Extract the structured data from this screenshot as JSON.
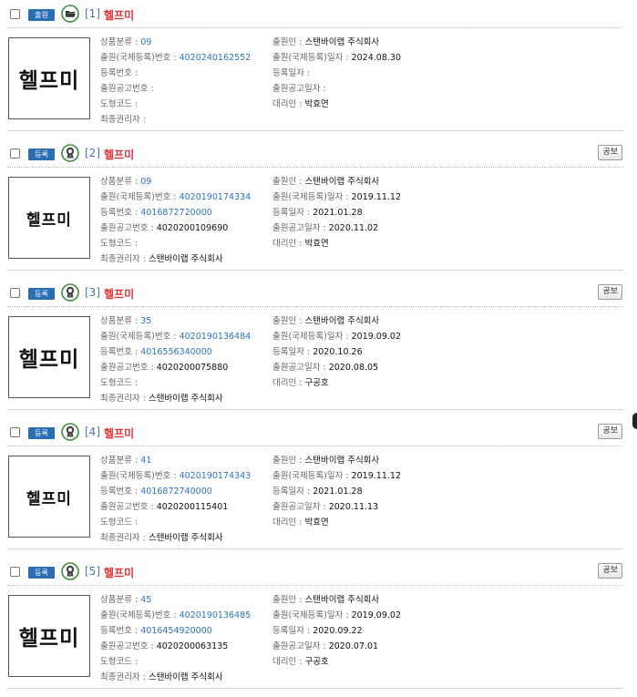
{
  "labels": {
    "class": "상품분류",
    "app_no": "출원(국제등록)번호",
    "reg_no": "등록번호",
    "pub_no": "출원공고번호",
    "design_code": "도형코드",
    "final_holder": "최종권리자",
    "applicant": "출원인",
    "app_date": "출원(국제등록)일자",
    "reg_date": "등록일자",
    "pub_date": "출원공고일자",
    "agent": "대리인",
    "sep": " : "
  },
  "gongbo_label": "공보",
  "colors": {
    "badge_bg": "#2a6fb4",
    "title": "#e0363a",
    "link": "#2f73b8",
    "number": "#4a74a8"
  },
  "results": [
    {
      "badge": "출원",
      "status_icon": "folder-open-icon",
      "number": "[1]",
      "title": "헬프미",
      "mark_text": "헬프미",
      "show_gongbo": false,
      "class": "09",
      "app_no": "4020240162552",
      "reg_no": "",
      "pub_no": "",
      "design_code": "",
      "final_holder": "",
      "applicant": "스탠바이랩 주식회사",
      "app_date": "2024.08.30",
      "reg_date": "",
      "pub_date": "",
      "agent": "박효연"
    },
    {
      "badge": "등록",
      "status_icon": "registered-seal-icon",
      "number": "[2]",
      "title": "헬프미",
      "mark_text": "헬프미",
      "show_gongbo": true,
      "class": "09",
      "app_no": "4020190174334",
      "reg_no": "4016872720000",
      "pub_no": "4020200109690",
      "design_code": "",
      "final_holder": "스탠바이랩 주식회사",
      "applicant": "스탠바이랩 주식회사",
      "app_date": "2019.11.12",
      "reg_date": "2021.01.28",
      "pub_date": "2020.11.02",
      "agent": "박효연"
    },
    {
      "badge": "등록",
      "status_icon": "registered-seal-icon",
      "number": "[3]",
      "title": "헬프미",
      "mark_text": "헬프미",
      "show_gongbo": true,
      "class": "35",
      "app_no": "4020190136484",
      "reg_no": "4016556340000",
      "pub_no": "4020200075880",
      "design_code": "",
      "final_holder": "스탠바이랩 주식회사",
      "applicant": "스탠바이랩 주식회사",
      "app_date": "2019.09.02",
      "reg_date": "2020.10.26",
      "pub_date": "2020.08.05",
      "agent": "구공호"
    },
    {
      "badge": "등록",
      "status_icon": "registered-seal-icon",
      "number": "[4]",
      "title": "헬프미",
      "mark_text": "헬프미",
      "show_gongbo": true,
      "class": "41",
      "app_no": "4020190174343",
      "reg_no": "4016872740000",
      "pub_no": "4020200115401",
      "design_code": "",
      "final_holder": "스탠바이랩 주식회사",
      "applicant": "스탠바이랩 주식회사",
      "app_date": "2019.11.12",
      "reg_date": "2021.01.28",
      "pub_date": "2020.11.13",
      "agent": "박효연"
    },
    {
      "badge": "등록",
      "status_icon": "registered-seal-icon",
      "number": "[5]",
      "title": "헬프미",
      "mark_text": "헬프미",
      "show_gongbo": true,
      "class": "45",
      "app_no": "4020190136485",
      "reg_no": "4016454920000",
      "pub_no": "4020200063135",
      "design_code": "",
      "final_holder": "스탠바이랩 주식회사",
      "applicant": "스탠바이랩 주식회사",
      "app_date": "2019.09.02",
      "reg_date": "2020.09.22",
      "pub_date": "2020.07.01",
      "agent": "구공호"
    }
  ]
}
